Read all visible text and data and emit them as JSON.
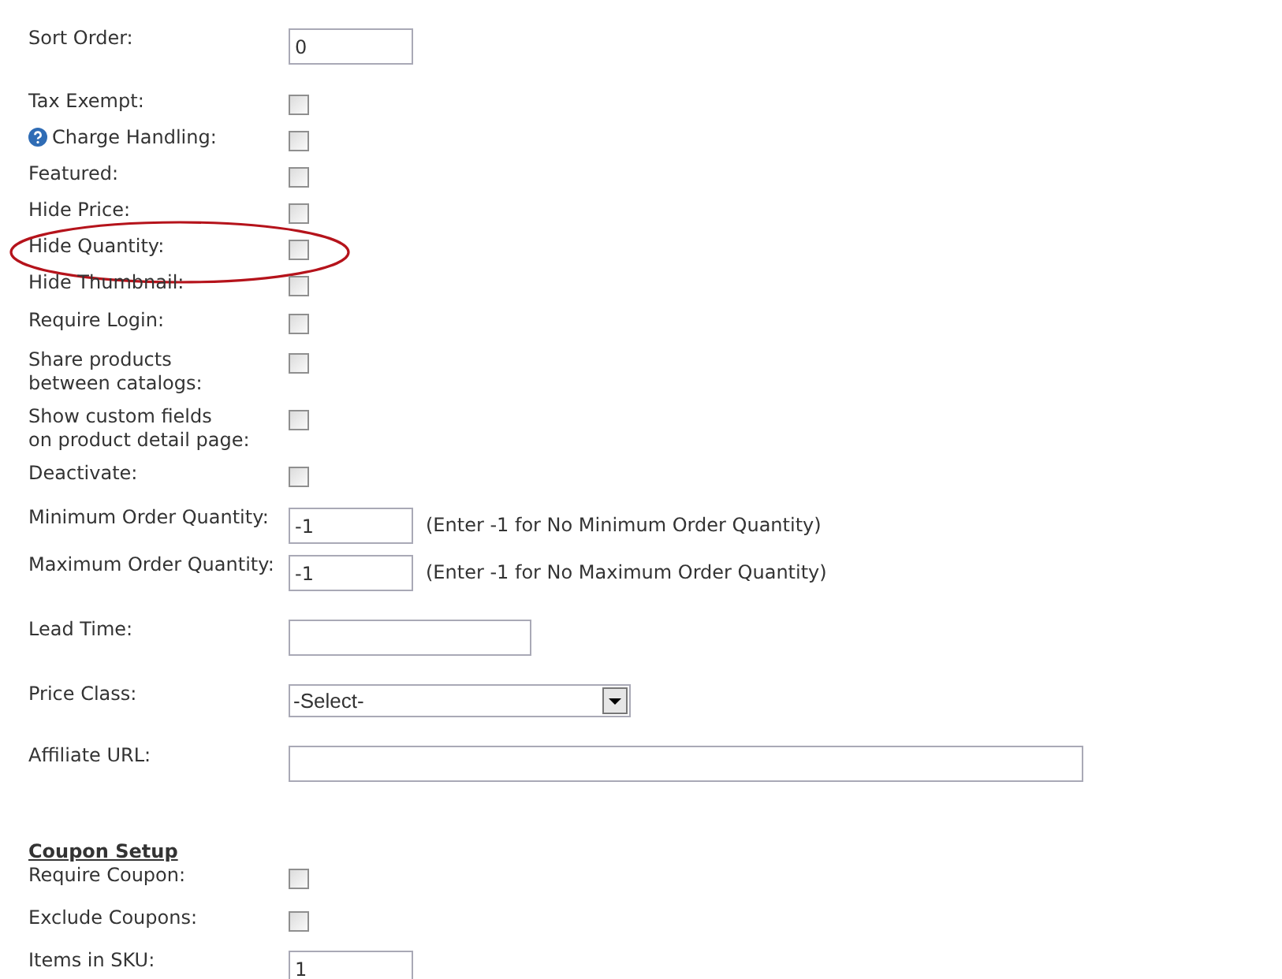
{
  "rows": [
    {
      "kind": "number",
      "label": "Sort Order:",
      "value": "0"
    },
    {
      "kind": "checkbox",
      "label": "Tax Exempt:",
      "checked": false
    },
    {
      "kind": "checkbox",
      "label": "Charge Handling:",
      "checked": false,
      "help": true
    },
    {
      "kind": "checkbox",
      "label": "Featured:",
      "checked": false
    },
    {
      "kind": "checkbox",
      "label": "Hide Price:",
      "checked": false
    },
    {
      "kind": "checkbox",
      "label": "Hide Quantity:",
      "checked": false,
      "circled": true
    },
    {
      "kind": "checkbox",
      "label": "Hide Thumbnail:",
      "checked": false
    },
    {
      "kind": "checkbox",
      "label": "Require Login:",
      "checked": false
    },
    {
      "kind": "checkbox",
      "label": "Share products\nbetween catalogs:",
      "checked": false
    },
    {
      "kind": "checkbox",
      "label": "Show custom fields\non product detail page:",
      "checked": false
    },
    {
      "kind": "checkbox",
      "label": "Deactivate:",
      "checked": false
    },
    {
      "kind": "limit",
      "label": "Minimum Order Quantity:",
      "value": "-1",
      "hint": "(Enter -1 for No Minimum Order Quantity)"
    },
    {
      "kind": "limit",
      "label": "Maximum Order Quantity:",
      "value": "-1",
      "hint": "(Enter -1 for No Maximum Order Quantity)"
    },
    {
      "kind": "text",
      "label": "Lead Time:",
      "value": ""
    },
    {
      "kind": "select",
      "label": "Price Class:",
      "value": "-Select-"
    },
    {
      "kind": "url",
      "label": "Affiliate URL:",
      "value": ""
    },
    {
      "kind": "heading",
      "label": "Coupon Setup"
    },
    {
      "kind": "checkbox",
      "label": "Require Coupon:",
      "checked": false
    },
    {
      "kind": "checkbox",
      "label": "Exclude Coupons:",
      "checked": false
    },
    {
      "kind": "number",
      "label": "Items in SKU:",
      "value": "1"
    }
  ]
}
